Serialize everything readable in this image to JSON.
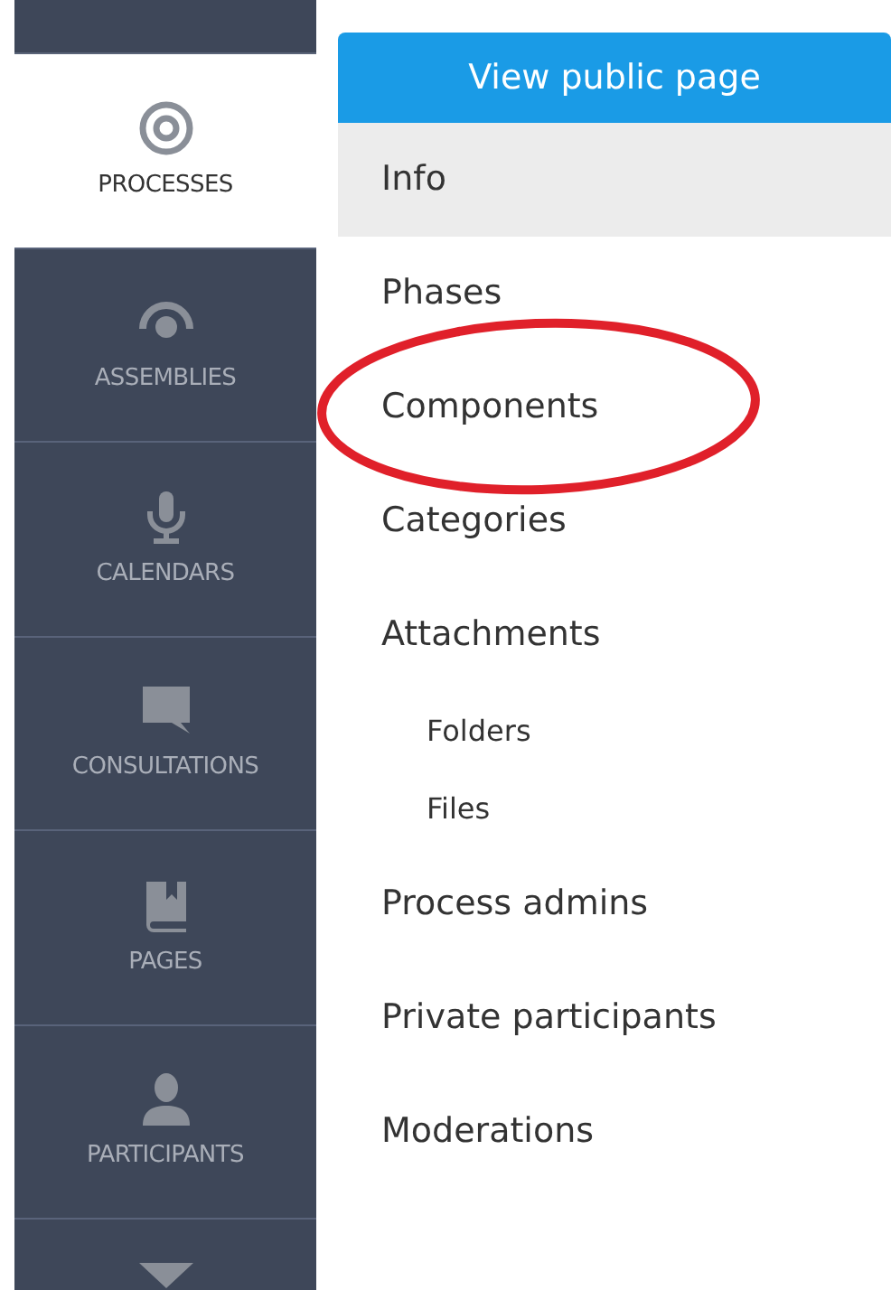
{
  "sidebar": {
    "items": [
      {
        "label": "PROCESSES",
        "selected": true
      },
      {
        "label": "ASSEMBLIES",
        "selected": false
      },
      {
        "label": "CALENDARS",
        "selected": false
      },
      {
        "label": "CONSULTATIONS",
        "selected": false
      },
      {
        "label": "PAGES",
        "selected": false
      },
      {
        "label": "PARTICIPANTS",
        "selected": false
      }
    ]
  },
  "view_public_button": "View public page",
  "menu": [
    {
      "label": "Info",
      "selected": true
    },
    {
      "label": "Phases",
      "selected": false
    },
    {
      "label": "Components",
      "selected": false
    },
    {
      "label": "Categories",
      "selected": false
    },
    {
      "label": "Attachments",
      "selected": false,
      "children": [
        {
          "label": "Folders",
          "selected": false
        },
        {
          "label": "Files",
          "selected": false
        }
      ]
    },
    {
      "label": "Process admins",
      "selected": false
    },
    {
      "label": "Private participants",
      "selected": false
    },
    {
      "label": "Moderations",
      "selected": false
    }
  ],
  "annotations": [
    {
      "kind": "ellipse"
    }
  ]
}
